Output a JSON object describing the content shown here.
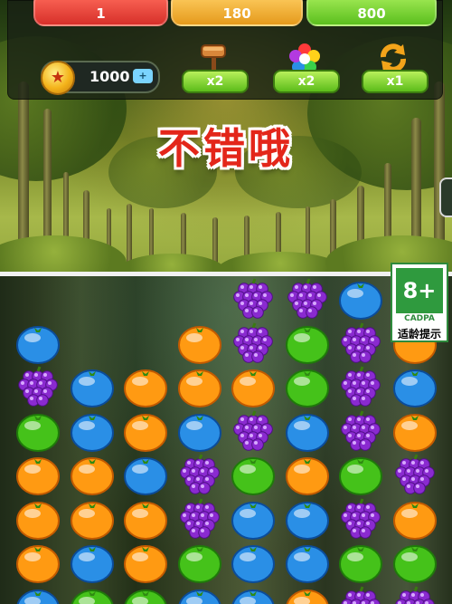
{
  "hud": {
    "level": "1",
    "score": "180",
    "target": "800",
    "coins": "1000"
  },
  "tools": [
    {
      "name": "hammer",
      "count": "x2"
    },
    {
      "name": "flower",
      "count": "x2"
    },
    {
      "name": "shuffle",
      "count": "x1"
    }
  ],
  "praise": "不错哦",
  "rating": {
    "age": "8+",
    "org": "CADPA",
    "note": "适龄提示"
  },
  "colors": {
    "orange": "#ff9a12",
    "blue": "#2a8fe6",
    "green": "#45c21a",
    "grape": "#8a2ad0",
    "praise_red": "#e3261a"
  },
  "board": {
    "grid": [
      [
        "",
        "",
        "",
        "",
        "grape",
        "grape",
        "blue",
        ""
      ],
      [
        "blue",
        "",
        "",
        "orange",
        "grape",
        "green",
        "grape",
        "orange"
      ],
      [
        "grape",
        "blue",
        "orange",
        "orange",
        "orange",
        "green",
        "grape",
        "blue"
      ],
      [
        "green",
        "blue",
        "orange",
        "blue",
        "grape",
        "blue",
        "grape",
        "orange"
      ],
      [
        "orange",
        "orange",
        "blue",
        "grape",
        "green",
        "orange",
        "green",
        "grape"
      ],
      [
        "orange",
        "orange",
        "orange",
        "grape",
        "blue",
        "blue",
        "grape",
        "orange"
      ],
      [
        "orange",
        "blue",
        "orange",
        "green",
        "blue",
        "blue",
        "green",
        "green"
      ],
      [
        "blue",
        "green",
        "green",
        "blue",
        "blue",
        "orange",
        "grape",
        "grape"
      ]
    ]
  }
}
